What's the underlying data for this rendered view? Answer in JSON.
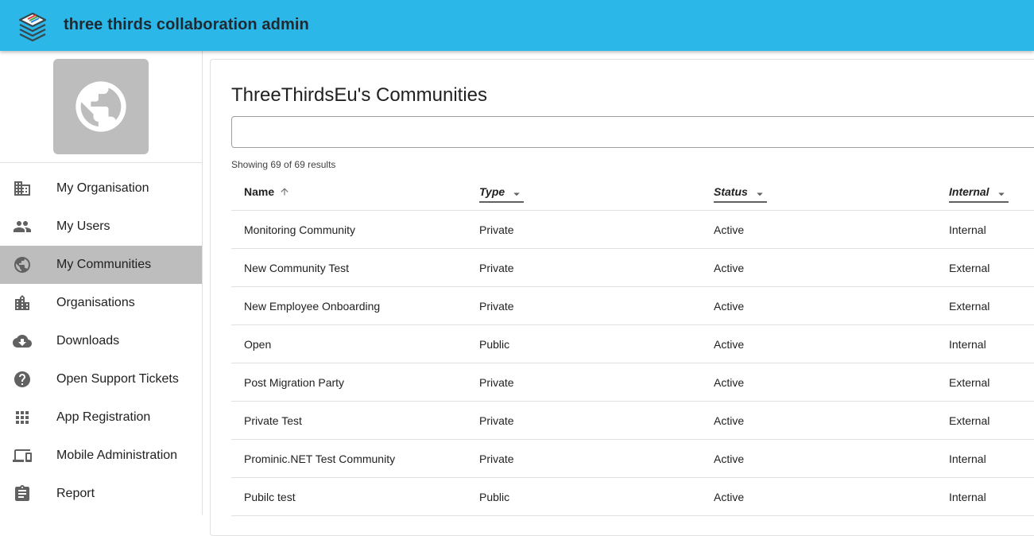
{
  "app": {
    "title": "three thirds collaboration admin"
  },
  "sidebar": {
    "items": [
      {
        "label": "My Organisation",
        "icon": "building-icon"
      },
      {
        "label": "My Users",
        "icon": "people-icon"
      },
      {
        "label": "My Communities",
        "icon": "globe-icon",
        "active": true
      },
      {
        "label": "Organisations",
        "icon": "city-icon"
      },
      {
        "label": "Downloads",
        "icon": "cloud-download-icon"
      },
      {
        "label": "Open Support Tickets",
        "icon": "help-icon"
      },
      {
        "label": "App Registration",
        "icon": "apps-icon"
      },
      {
        "label": "Mobile Administration",
        "icon": "devices-icon"
      },
      {
        "label": "Report",
        "icon": "clipboard-icon"
      }
    ]
  },
  "main": {
    "title": "ThreeThirdsEu's Communities",
    "search": {
      "value": "",
      "placeholder": ""
    },
    "results_text": "Showing 69 of 69 results",
    "columns": [
      "Name",
      "Type",
      "Status",
      "Internal"
    ],
    "rows": [
      [
        "Monitoring Community",
        "Private",
        "Active",
        "Internal"
      ],
      [
        "New Community Test",
        "Private",
        "Active",
        "External"
      ],
      [
        "New Employee Onboarding",
        "Private",
        "Active",
        "External"
      ],
      [
        "Open",
        "Public",
        "Active",
        "Internal"
      ],
      [
        "Post Migration Party",
        "Private",
        "Active",
        "External"
      ],
      [
        "Private Test",
        "Private",
        "Active",
        "External"
      ],
      [
        "Prominic.NET Test Community",
        "Private",
        "Active",
        "Internal"
      ],
      [
        "Pubilc test",
        "Public",
        "Active",
        "Internal"
      ]
    ]
  },
  "colors": {
    "appbar": "#2bb8e8",
    "active_nav": "#bdbdbd",
    "avatar_bg": "#bdbdbd"
  }
}
